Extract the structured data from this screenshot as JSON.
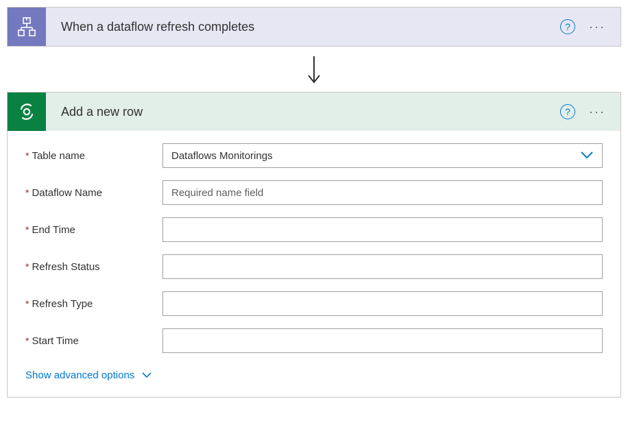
{
  "trigger": {
    "title": "When a dataflow refresh completes"
  },
  "action": {
    "title": "Add a new row",
    "fields": {
      "table_name": {
        "label": "Table name",
        "value": "Dataflows Monitorings"
      },
      "dataflow_name": {
        "label": "Dataflow Name",
        "placeholder": "Required name field",
        "value": ""
      },
      "end_time": {
        "label": "End Time",
        "value": ""
      },
      "refresh_status": {
        "label": "Refresh Status",
        "value": ""
      },
      "refresh_type": {
        "label": "Refresh Type",
        "value": ""
      },
      "start_time": {
        "label": "Start Time",
        "value": ""
      }
    },
    "advanced_label": "Show advanced options"
  }
}
